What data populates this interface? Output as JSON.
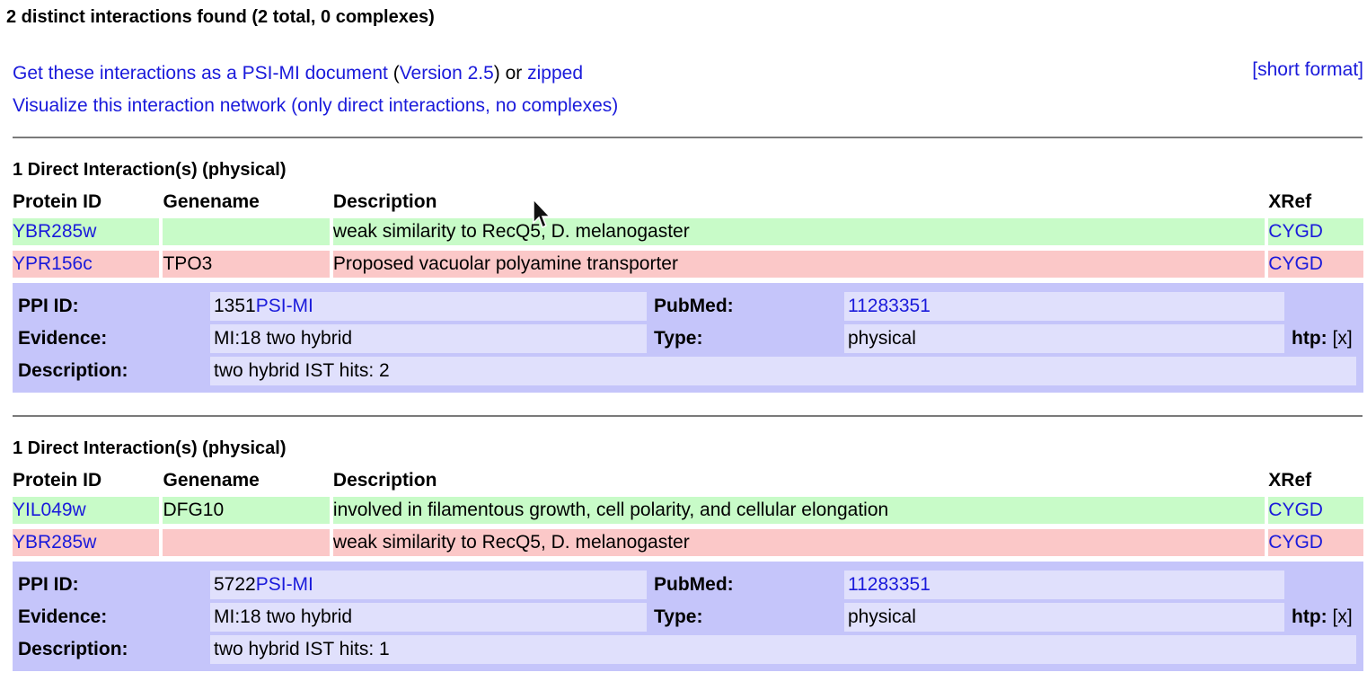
{
  "summary": "2 distinct interactions found (2 total, 0 complexes)",
  "links": {
    "psi_text": "Get these interactions as a PSI-MI document",
    "version_open": " (",
    "version": "Version 2.5",
    "version_close": ") or ",
    "zipped": "zipped",
    "visualize": "Visualize this interaction network (only direct interactions, no complexes)",
    "short_format": "[short format]"
  },
  "table_headers": {
    "protein_id": "Protein ID",
    "genename": "Genename",
    "description": "Description",
    "xref": "XRef"
  },
  "ppi_labels": {
    "ppi_id": "PPI ID:",
    "pubmed": "PubMed:",
    "evidence": "Evidence:",
    "type": "Type:",
    "description": "Description:",
    "htp": "htp:",
    "htp_value": "[x]",
    "psi_mi": "PSI-MI"
  },
  "interactions": [
    {
      "title": "1 Direct Interaction(s) (physical)",
      "proteins": [
        {
          "id": "YBR285w",
          "gene": "",
          "description": "weak similarity to RecQ5, D. melanogaster",
          "xref": "CYGD"
        },
        {
          "id": "YPR156c",
          "gene": "TPO3",
          "description": "Proposed vacuolar polyamine transporter",
          "xref": "CYGD"
        }
      ],
      "ppi_id": "1351",
      "pubmed": "11283351",
      "evidence": "MI:18 two hybrid",
      "type": "physical",
      "description": "two hybrid IST hits: 2"
    },
    {
      "title": "1 Direct Interaction(s) (physical)",
      "proteins": [
        {
          "id": "YIL049w",
          "gene": "DFG10",
          "description": "involved in filamentous growth, cell polarity, and cellular elongation",
          "xref": "CYGD"
        },
        {
          "id": "YBR285w",
          "gene": "",
          "description": "weak similarity to RecQ5, D. melanogaster",
          "xref": "CYGD"
        }
      ],
      "ppi_id": "5722",
      "pubmed": "11283351",
      "evidence": "MI:18 two hybrid",
      "type": "physical",
      "description": "two hybrid IST hits: 1"
    }
  ]
}
